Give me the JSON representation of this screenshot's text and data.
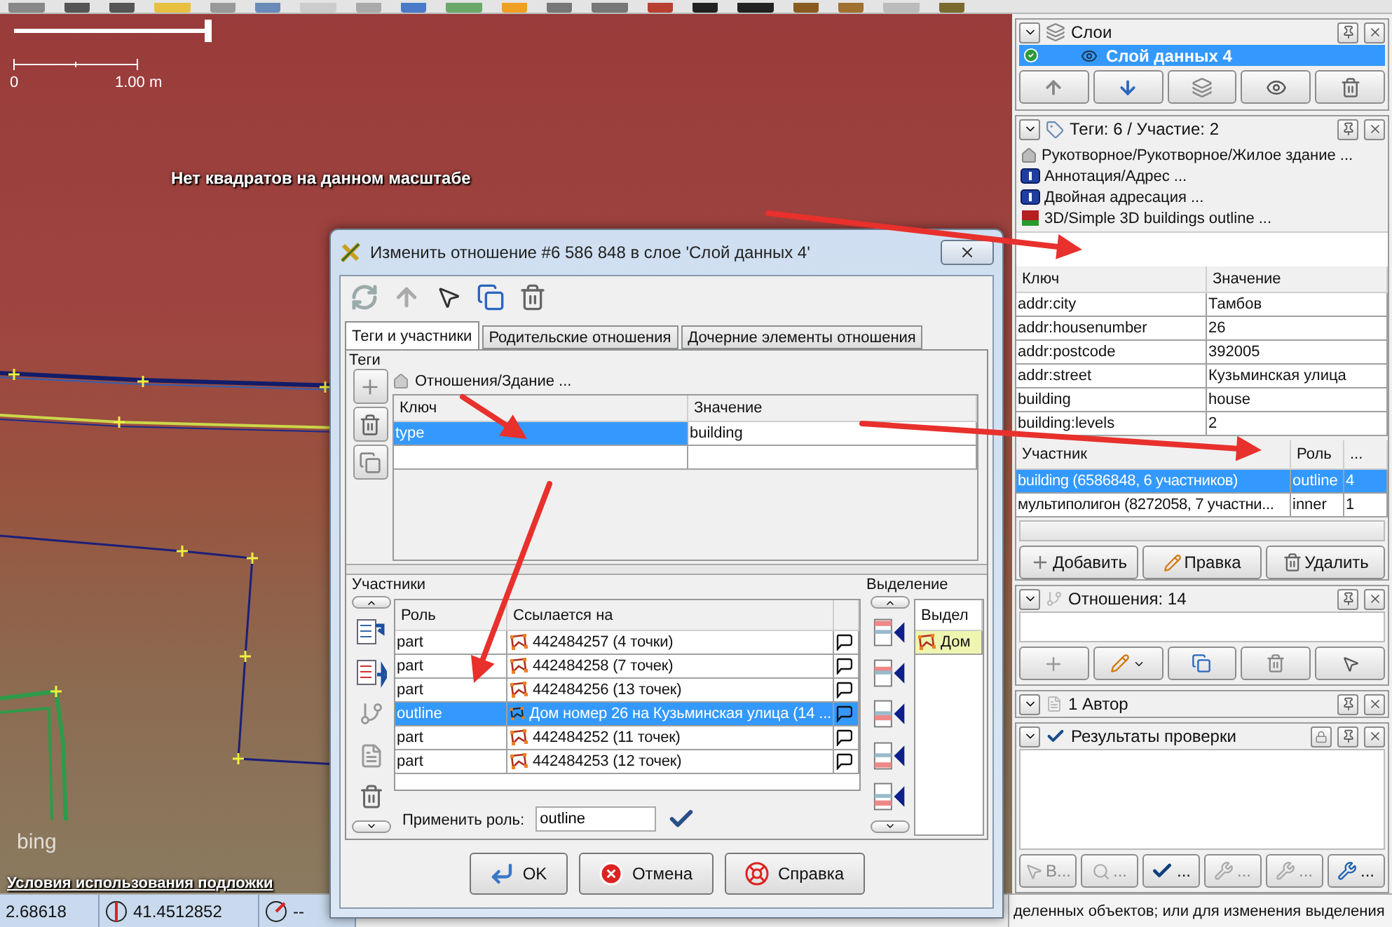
{
  "map": {
    "scale_start": "0",
    "scale_end": "1.00 m",
    "message": "Нет квадратов на данном масштабе",
    "imagery_logo": "bing",
    "imagery_terms": "Условия использования подложки"
  },
  "status_bar": {
    "longitude": "2.68618",
    "latitude": "41.4512852",
    "heading": "--",
    "help": "деленных объектов; или для изменения выделения"
  },
  "layers_panel": {
    "title": "Слои",
    "layers": [
      {
        "name": "Слой данных 4",
        "selected": true,
        "visible": true
      }
    ]
  },
  "tags_panel": {
    "title": "Теги: 6 / Участие: 2",
    "presets": [
      {
        "kind": "building",
        "label": "Рукотворное/Рукотворное/Жилое здание ..."
      },
      {
        "kind": "address",
        "label": "Аннотация/Адрес ..."
      },
      {
        "kind": "address",
        "label": "Двойная адресация ..."
      },
      {
        "kind": "model",
        "label": "3D/Simple 3D buildings outline ..."
      }
    ],
    "columns": [
      "Ключ",
      "Значение"
    ],
    "tags": [
      {
        "key": "addr:city",
        "value": "Тамбов"
      },
      {
        "key": "addr:housenumber",
        "value": "26"
      },
      {
        "key": "addr:postcode",
        "value": "392005"
      },
      {
        "key": "addr:street",
        "value": "Кузьминская улица"
      },
      {
        "key": "building",
        "value": "house"
      },
      {
        "key": "building:levels",
        "value": "2"
      }
    ],
    "membership_columns": [
      "Участник",
      "Роль",
      "..."
    ],
    "memberships": [
      {
        "relation": "building (6586848, 6 участников)",
        "role": "outline",
        "column_3": "4",
        "selected": true
      },
      {
        "relation": "мультиполигон (8272058, 7 участни...",
        "role": "inner",
        "column_3": "1",
        "selected": false
      }
    ],
    "buttons": [
      {
        "kind": "add",
        "label": "Добавить"
      },
      {
        "kind": "edit",
        "label": "Правка"
      },
      {
        "kind": "delete",
        "label": "Удалить"
      }
    ]
  },
  "relations_panel": {
    "title": "Отношения: 14"
  },
  "authors_panel": {
    "title": "1 Автор"
  },
  "validation_panel": {
    "title": "Результаты проверки",
    "buttons": [
      {
        "kind": "select",
        "label": "В...",
        "disabled": true
      },
      {
        "kind": "zoom",
        "label": "...",
        "disabled": true
      },
      {
        "kind": "validate",
        "label": "...",
        "disabled": false
      },
      {
        "kind": "fix",
        "label": "...",
        "disabled": true
      },
      {
        "kind": "fix",
        "label": "...",
        "disabled": true
      },
      {
        "kind": "ignore",
        "label": "...",
        "disabled": false
      }
    ]
  },
  "dialog": {
    "title": "Изменить отношение #6 586 848 в слое 'Слой данных 4'",
    "tabs": [
      {
        "label": "Теги и участники",
        "selected": true
      },
      {
        "label": "Родительские отношения",
        "selected": false
      },
      {
        "label": "Дочерние элементы отношения",
        "selected": false
      }
    ],
    "tags_label": "Теги",
    "preset": "Отношения/Здание ...",
    "tag_columns": [
      "Ключ",
      "Значение"
    ],
    "tags": [
      {
        "key": "type",
        "value": "building",
        "selected": true
      }
    ],
    "members_label": "Участники",
    "member_columns": [
      "Роль",
      "Ссылается на"
    ],
    "members": [
      {
        "role": "part",
        "ref": "442484257 (4 точки)",
        "selected": false
      },
      {
        "role": "part",
        "ref": "442484258 (7 точек)",
        "selected": false
      },
      {
        "role": "part",
        "ref": "442484256 (13 точек)",
        "selected": false
      },
      {
        "role": "outline",
        "ref": "Дом номер 26 на Кузьминская улица (14 ...",
        "selected": true
      },
      {
        "role": "part",
        "ref": "442484252 (11 точек)",
        "selected": false
      },
      {
        "role": "part",
        "ref": "442484253 (12 точек)",
        "selected": false
      }
    ],
    "selection_label": "Выделение",
    "selection_column": "Выдел",
    "selection": [
      {
        "label": "Дом"
      }
    ],
    "apply_role_label": "Применить роль:",
    "apply_role_value": "outline",
    "buttons": [
      {
        "kind": "ok",
        "label": "OK"
      },
      {
        "kind": "cancel",
        "label": "Отмена"
      },
      {
        "kind": "help",
        "label": "Справка"
      }
    ]
  }
}
